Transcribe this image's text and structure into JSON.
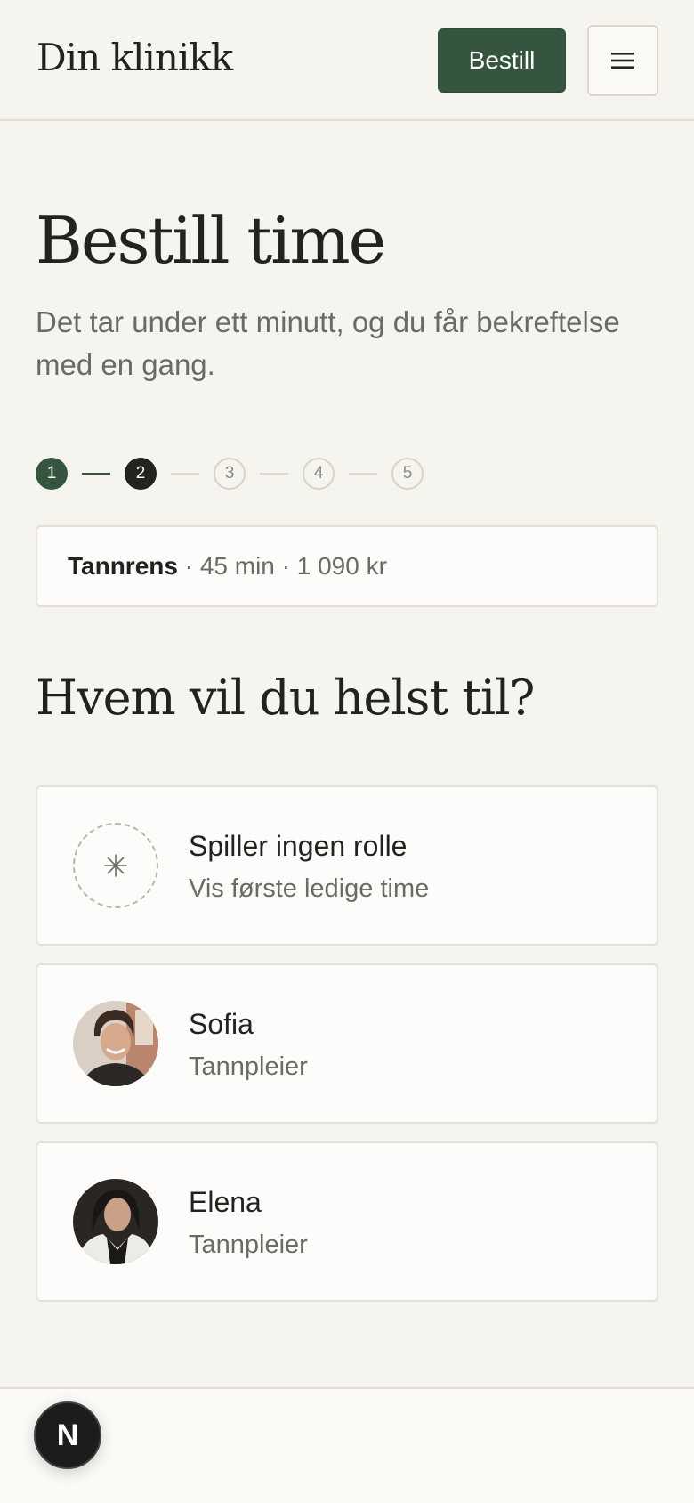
{
  "header": {
    "logo": "Din klinikk",
    "book_label": "Bestill",
    "menu_icon": "hamburger-menu-icon"
  },
  "main": {
    "title": "Bestill time",
    "lead": "Det tar under ett minutt, og du får bekreftelse med en gang.",
    "steps": [
      {
        "label": "1",
        "state": "done"
      },
      {
        "label": "2",
        "state": "active"
      },
      {
        "label": "3",
        "state": "todo"
      },
      {
        "label": "4",
        "state": "todo"
      },
      {
        "label": "5",
        "state": "todo"
      }
    ],
    "summary": {
      "service": "Tannrens",
      "details": " · 45 min · 1 090 kr"
    },
    "section_title": "Hvem vil du helst til?",
    "options": [
      {
        "name": "Spiller ingen rolle",
        "sub": "Vis første ledige time",
        "icon": "asterisk-icon"
      },
      {
        "name": "Sofia",
        "sub": "Tannpleier",
        "icon": "avatar-photo"
      },
      {
        "name": "Elena",
        "sub": "Tannpleier",
        "icon": "avatar-photo"
      }
    ]
  },
  "dev_badge": {
    "label": "N"
  },
  "colors": {
    "accent": "#36553f",
    "background": "#f6f4ef",
    "text": "#22221f",
    "muted": "#6b6a64"
  }
}
